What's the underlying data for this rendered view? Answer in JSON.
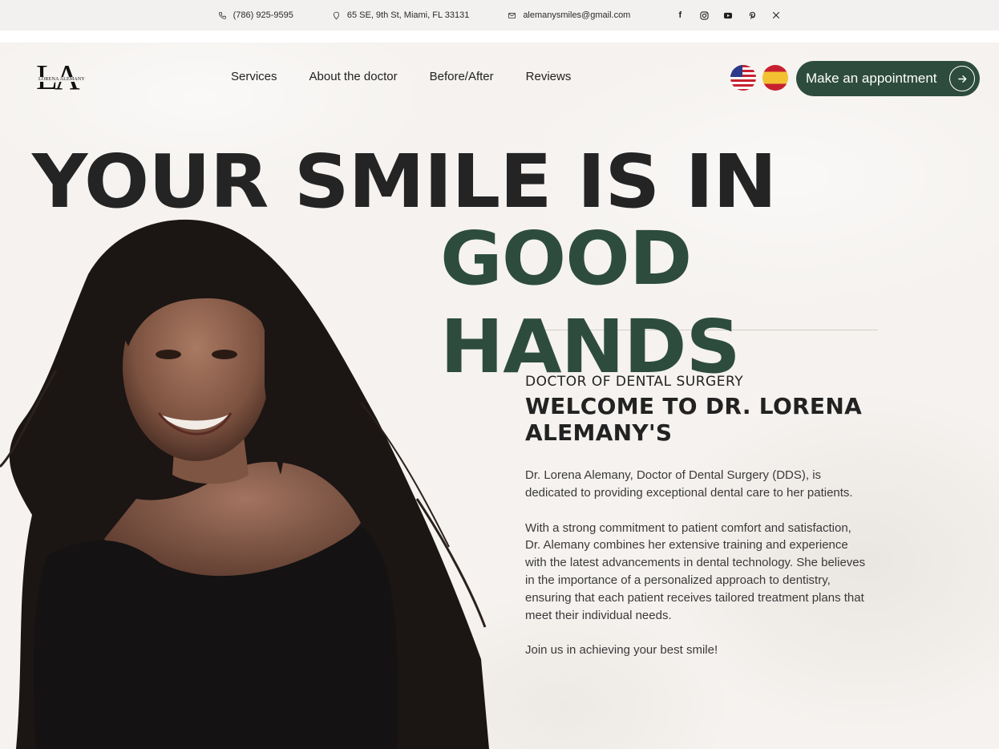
{
  "topbar": {
    "phone": "(786) 925-9595",
    "address": "65 SE, 9th St, Miami, FL 33131",
    "email": "alemanysmiles@gmail.com",
    "social_icons": [
      "facebook-icon",
      "instagram-icon",
      "youtube-icon",
      "pinterest-icon",
      "x-icon"
    ]
  },
  "logo": {
    "letters": "LA",
    "name": "LORENA ALEMANY"
  },
  "nav": {
    "items": [
      {
        "label": "Services"
      },
      {
        "label": "About the doctor"
      },
      {
        "label": "Before/After"
      },
      {
        "label": "Reviews"
      }
    ],
    "languages": [
      "english-flag",
      "spanish-flag"
    ],
    "cta_label": "Make an appointment"
  },
  "hero": {
    "line1": "YOUR SMILE IS IN",
    "line2": "GOOD HANDS"
  },
  "content": {
    "eyebrow": "DOCTOR OF DENTAL SURGERY",
    "welcome": "WELCOME TO DR. LORENA ALEMANY'S",
    "paragraphs": [
      "Dr. Lorena Alemany, Doctor of Dental Surgery (DDS), is dedicated to providing exceptional dental care to her patients.",
      "With a strong commitment to patient comfort and satisfaction, Dr. Alemany combines her extensive training and experience with the latest advancements in dental technology. She believes in the importance of a personalized approach to dentistry, ensuring that each patient receives tailored treatment plans that meet their individual needs.",
      "Join us in achieving your best smile!"
    ]
  },
  "colors": {
    "accent": "#2d4c3d",
    "background": "#f5f2ef",
    "text": "#222222"
  }
}
